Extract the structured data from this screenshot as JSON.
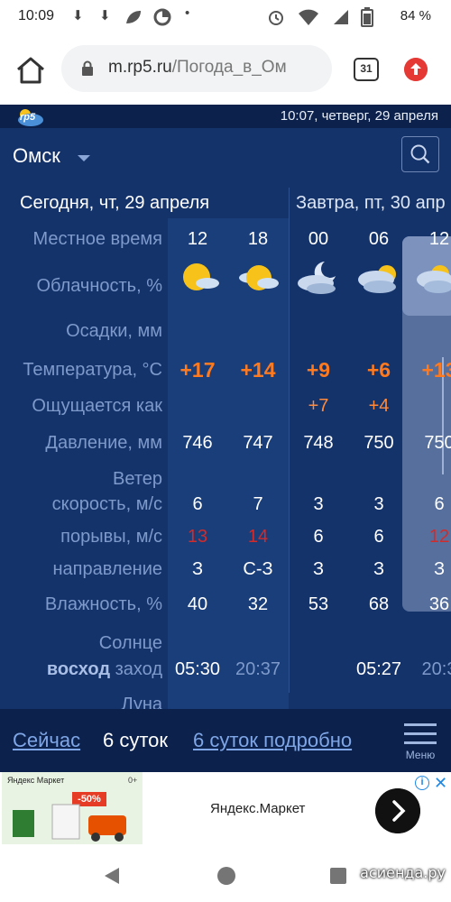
{
  "status_bar": {
    "time": "10:09",
    "battery": "84 %",
    "icons": [
      "download-icon",
      "download-icon",
      "leaf-icon",
      "data-saver-icon",
      "dot-icon",
      "alarm-icon",
      "wifi-icon",
      "signal-icon",
      "battery-icon"
    ]
  },
  "browser": {
    "url_host": "m.rp5.ru",
    "url_path": "/Погода_в_Ом",
    "tab_count": "31"
  },
  "app": {
    "logo": "rp5",
    "datetime": "10:07, четверг, 29 апреля",
    "city": "Омск",
    "today_title": "Сегодня, чт, 29 апреля",
    "tomorrow_title": "Завтра, пт, 30 апр",
    "row_labels": {
      "local_time": "Местное время",
      "cloudiness": "Облачность, %",
      "precip": "Осадки, мм",
      "temperature": "Температура, °C",
      "feels_like": "Ощущается как",
      "pressure": "Давление, мм",
      "wind": "Ветер",
      "wind_speed": "скорость, м/с",
      "wind_gusts": "порывы, м/с",
      "wind_dir": "направление",
      "humidity": "Влажность, %",
      "sun": "Солнце",
      "sunrise": "восход",
      "sunset": "заход",
      "moon": "Луна"
    },
    "columns": [
      {
        "hour": "12",
        "icon": "sun-cloud-icon",
        "temp": "+17",
        "feels": "",
        "pressure": "746",
        "speed": "6",
        "gust": "13",
        "dir": "З",
        "humidity": "40",
        "sun": "05:30"
      },
      {
        "hour": "18",
        "icon": "sun-cloud-icon",
        "temp": "+14",
        "feels": "",
        "pressure": "747",
        "speed": "7",
        "gust": "14",
        "dir": "С-З",
        "humidity": "32",
        "sun": "20:37"
      },
      {
        "hour": "00",
        "icon": "moon-cloud-icon",
        "temp": "+9",
        "feels": "+7",
        "pressure": "748",
        "speed": "3",
        "gust": "6",
        "dir": "З",
        "humidity": "53",
        "sun": ""
      },
      {
        "hour": "06",
        "icon": "cloud-sun-icon",
        "temp": "+6",
        "feels": "+4",
        "pressure": "750",
        "speed": "3",
        "gust": "6",
        "dir": "З",
        "humidity": "68",
        "sun": "05:27"
      },
      {
        "hour": "12",
        "icon": "cloud-sun-icon",
        "temp": "+13",
        "feels": "",
        "pressure": "750",
        "speed": "6",
        "gust": "12",
        "dir": "З",
        "humidity": "36",
        "sun": "20:3"
      }
    ]
  },
  "bottom_nav": {
    "now": "Сейчас",
    "six_days": "6 суток",
    "six_days_detail": "6 суток подробно",
    "menu": "Меню"
  },
  "ad": {
    "brand": "Яндекс Маркет",
    "age": "0+",
    "sale": "-50%",
    "text": "Яндекс.Маркет"
  },
  "watermark": "асиенда.ру",
  "colors": {
    "app_bg": "#15336b",
    "header_bg": "#0c224d",
    "temperature": "#ff7a1f",
    "gusts": "#d22b2b",
    "label": "#7e9acb",
    "link": "#7fa6e6"
  }
}
